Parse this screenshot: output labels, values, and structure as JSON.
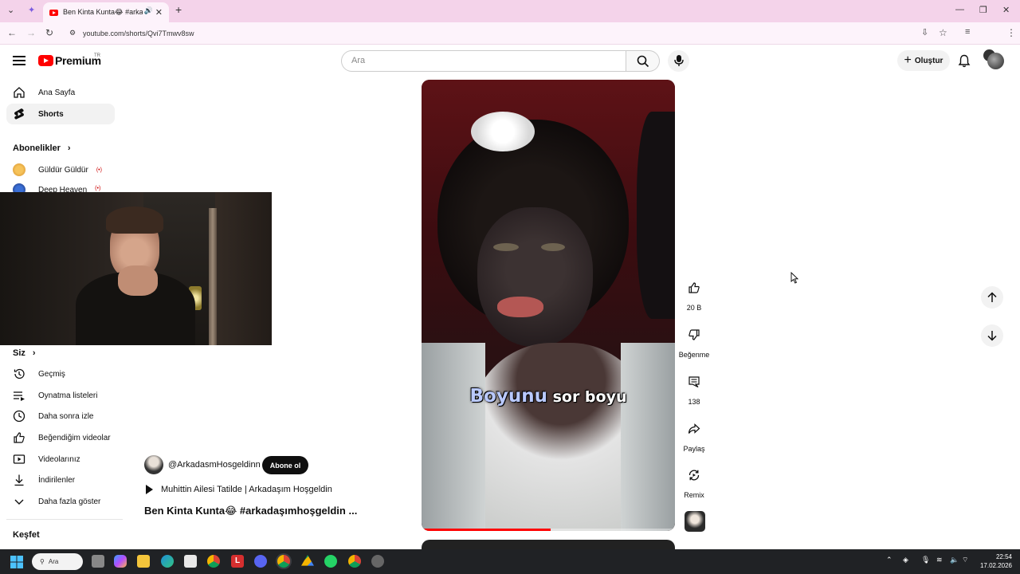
{
  "browser": {
    "tab_title": "Ben Kinta Kunta😂 #arkadaşımhoşgeldin",
    "url": "youtube.com/shorts/Qvi7Tmwv8sw"
  },
  "header": {
    "logo_text": "Premium",
    "country_code": "TR",
    "search_placeholder": "Ara",
    "create_label": "Oluştur"
  },
  "sidebar": {
    "main_items": [
      {
        "label": "Ana Sayfa",
        "icon": "home-icon"
      },
      {
        "label": "Shorts",
        "icon": "shorts-icon"
      }
    ],
    "subscriptions_title": "Abonelikler",
    "subscriptions": [
      {
        "label": "Güldür Güldür",
        "live": "(•)"
      },
      {
        "label": "Deep Heaven",
        "live": "(•)"
      }
    ],
    "you_title": "Siz",
    "you_items": [
      {
        "label": "Geçmiş",
        "icon": "history-icon"
      },
      {
        "label": "Oynatma listeleri",
        "icon": "playlists-icon"
      },
      {
        "label": "Daha sonra izle",
        "icon": "watch-later-icon"
      },
      {
        "label": "Beğendiğim videolar",
        "icon": "liked-icon"
      },
      {
        "label": "Videolarınız",
        "icon": "your-videos-icon"
      },
      {
        "label": "İndirilenler",
        "icon": "downloads-icon"
      },
      {
        "label": "Daha fazla göster",
        "icon": "chevron-down-icon"
      }
    ],
    "explore_title": "Keşfet"
  },
  "short": {
    "caption_highlight": "Boyunu",
    "caption_rest": "sor boyu",
    "progress": 0.51,
    "channel": "@ArkadasmHosgeldinn",
    "subscribe_label": "Abone ol",
    "related_title": "Muhittin Ailesi Tatilde | Arkadaşım Hoşgeldin",
    "title": "Ben Kinta Kunta😂 #arkadaşımhoşgeldin ..."
  },
  "actions": {
    "likes": "20 B",
    "dislike_label": "Beğenme",
    "comments": "138",
    "share_label": "Paylaş",
    "remix_label": "Remix"
  },
  "taskbar": {
    "search_label": "Ara",
    "time": "22:54",
    "date": "17.02.2026"
  }
}
